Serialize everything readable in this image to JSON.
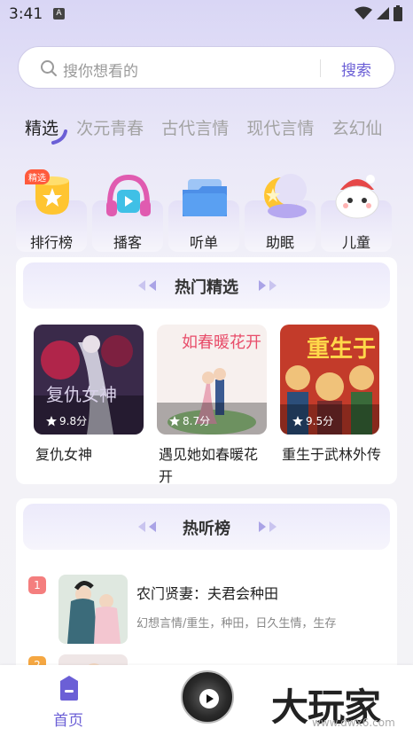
{
  "status": {
    "time": "3:41",
    "notif": "A"
  },
  "search": {
    "placeholder": "搜你想看的",
    "button": "搜索"
  },
  "categories": [
    "精选",
    "次元青春",
    "古代言情",
    "现代言情",
    "玄幻仙"
  ],
  "quick": [
    {
      "label": "排行榜",
      "badge": "精选"
    },
    {
      "label": "播客"
    },
    {
      "label": "听单"
    },
    {
      "label": "助眠"
    },
    {
      "label": "儿童"
    }
  ],
  "picks": {
    "title": "热门精选",
    "books": [
      {
        "title": "复仇女神",
        "rating": "9.8分",
        "cover_text": "复仇女神"
      },
      {
        "title": "遇见她如春暖花开",
        "rating": "8.7分",
        "cover_text": "如春暖花开"
      },
      {
        "title": "重生于武林外传",
        "rating": "9.5分",
        "cover_text": "重生于"
      }
    ]
  },
  "chart": {
    "title": "热听榜",
    "items": [
      {
        "rank": "1",
        "title": "农门贤妻：夫君会种田",
        "tags": "幻想言情/重生，种田，日久生情，生存",
        "color": "#f47e7e"
      },
      {
        "rank": "2",
        "title": "",
        "tags": "",
        "color": "#f5a742"
      }
    ]
  },
  "nav": {
    "home": "首页"
  },
  "watermark": {
    "main": "大玩家",
    "sub": "www.dwx6.com"
  }
}
